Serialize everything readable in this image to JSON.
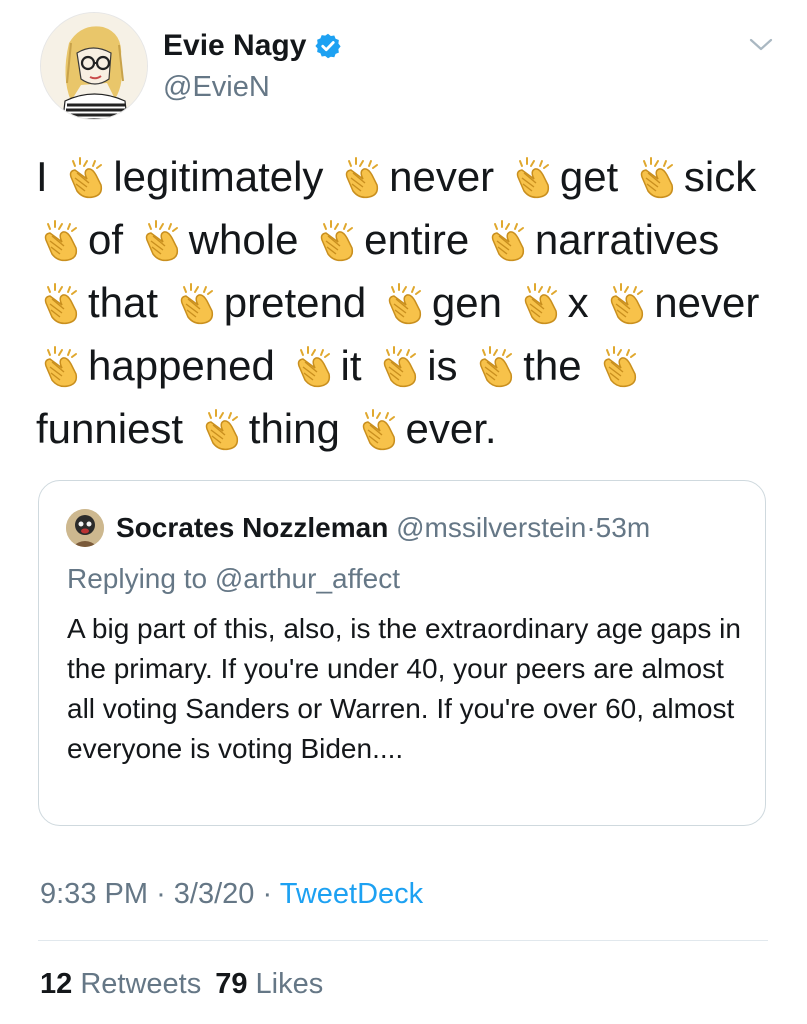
{
  "tweet": {
    "author": {
      "name": "Evie Nagy",
      "handle": "@EvieN",
      "verified": true
    },
    "text_words": [
      "I",
      "legitimately",
      "never",
      "get",
      "sick",
      "of",
      "whole",
      "entire",
      "narratives",
      "that",
      "pretend",
      "gen",
      "x",
      "never",
      "happened",
      "it",
      "is",
      "the",
      "funniest",
      "thing",
      "ever."
    ],
    "separator_icon": "clapping-hands-icon",
    "quoted": {
      "name": "Socrates Nozzleman",
      "handle": "@mssilverstein",
      "dot": "·",
      "time": "53m",
      "replying_prefix": "Replying to",
      "replying_to": "@arthur_affect",
      "body": "A big part of this, also, is the extraordinary age gaps in the primary. If you're under 40, your peers are almost all voting Sanders or Warren. If you're over 60, almost everyone is voting Biden...."
    },
    "meta": {
      "time": "9:33 PM",
      "sep1": "·",
      "date": "3/3/20",
      "sep2": "·",
      "source": "TweetDeck"
    },
    "stats": {
      "retweets_count": "12",
      "retweets_label": "Retweets",
      "likes_count": "79",
      "likes_label": "Likes"
    }
  },
  "colors": {
    "accent": "#1da1f2",
    "secondary_text": "#657786",
    "primary_text": "#14171a",
    "border": "#cfd9de",
    "clap": "#f7c24a"
  }
}
